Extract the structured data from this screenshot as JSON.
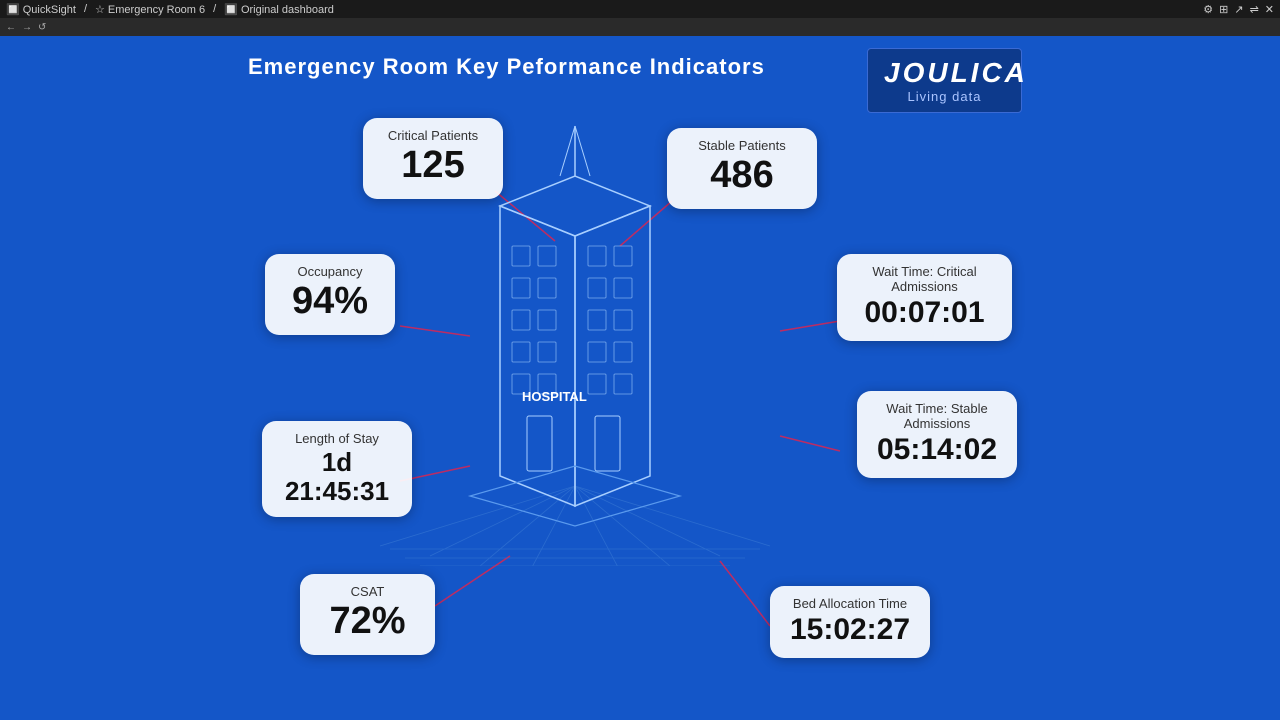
{
  "topbar": {
    "app_name": "QuickSight",
    "breadcrumb": "Emergency Room 6 / Original dashboard",
    "icons": [
      "←",
      "→",
      "↺"
    ]
  },
  "toolbar2": {
    "items": []
  },
  "dashboard": {
    "title": "Emergency Room  Key Peformance  Indicators",
    "logo": {
      "name": "JOULICA",
      "tagline": "Living data"
    },
    "kpis": {
      "critical_patients": {
        "label": "Critical Patients",
        "value": "125"
      },
      "stable_patients": {
        "label": "Stable Patients",
        "value": "486"
      },
      "occupancy": {
        "label": "Occupancy",
        "value": "94%"
      },
      "wait_time_critical": {
        "label": "Wait Time: Critical Admissions",
        "value": "00:07:01"
      },
      "length_of_stay": {
        "label": "Length of Stay",
        "value": "1d 21:45:31"
      },
      "wait_time_stable": {
        "label": "Wait Time: Stable Admissions",
        "value": "05:14:02"
      },
      "csat": {
        "label": "CSAT",
        "value": "72%"
      },
      "bed_allocation": {
        "label": "Bed Allocation Time",
        "value": "15:02:27"
      }
    }
  }
}
